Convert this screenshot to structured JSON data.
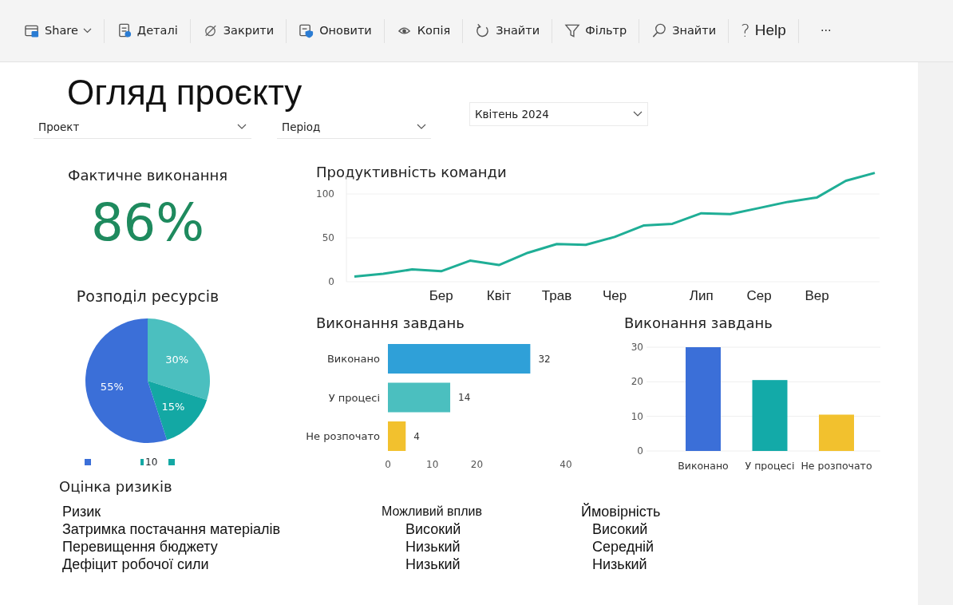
{
  "toolbar": [
    {
      "label": "Share",
      "dropdown": true
    },
    {
      "label": "Деталі"
    },
    {
      "label": "Закрити"
    },
    {
      "label": "Оновити"
    },
    {
      "label": "Копія"
    },
    {
      "label": "Знайти"
    },
    {
      "label": "Фільтр"
    },
    {
      "label": "Знайти"
    },
    {
      "label": "Help",
      "glyph": "?"
    },
    {
      "label": "···"
    }
  ],
  "title": "Огляд проєкту",
  "filters": [
    {
      "value": "Проект"
    },
    {
      "value": "Період"
    },
    {
      "value": "Квітень 2024"
    }
  ],
  "kpi": {
    "title": "Фактичне виконання",
    "value": "86%"
  },
  "resources": {
    "title": "Розподіл ресурсів",
    "chart_data": {
      "type": "pie",
      "values": [
        30,
        15,
        55
      ],
      "colors": [
        "#4bbfbf",
        "#13a8a4",
        "#3b6fd8"
      ],
      "data_labels": true,
      "value_labels": [
        "30%",
        "15%",
        "55%"
      ]
    },
    "legend": [
      {
        "color": "#3b6fd8"
      },
      {
        "color": "#13a8a4",
        "label": "10"
      },
      {
        "color": "#13a8a4"
      }
    ]
  },
  "productivity": {
    "title": "Продуктивність команди",
    "chart_data": {
      "type": "line",
      "categories": [
        null,
        null,
        null,
        "Бер",
        null,
        "Квіт",
        null,
        "Трав",
        null,
        "Чер",
        null,
        null,
        "Лип",
        null,
        "Сер",
        null,
        "Вер",
        null,
        null
      ],
      "series": [
        {
          "color": "#1fae96",
          "values": [
            6,
            9,
            14,
            12,
            24,
            19,
            33,
            43,
            42,
            51,
            64,
            66,
            78,
            77,
            84,
            91,
            96,
            115,
            124
          ]
        }
      ],
      "ylim": [
        0,
        125
      ],
      "yticks": [
        0,
        50,
        100
      ]
    }
  },
  "tasks_bar": {
    "title": "Виконання завдань",
    "chart_data": {
      "type": "bar",
      "orientation": "horizontal",
      "stacked": true,
      "categories": [
        "Виконано",
        "У процесі",
        "Не розпочато"
      ],
      "series": [
        {
          "color": "#2fa0d8",
          "values": [
            32,
            null,
            null
          ]
        },
        {
          "color": "#4bbfbf",
          "values": [
            null,
            14,
            null
          ]
        },
        {
          "color": "#f2c12e",
          "values": [
            null,
            null,
            4
          ]
        }
      ],
      "xlim": [
        0,
        40
      ],
      "xticks": [
        0,
        10,
        20,
        40
      ],
      "data_labels": true
    }
  },
  "tasks_column": {
    "title": "Виконання завдань",
    "chart_data": {
      "type": "bar",
      "orientation": "vertical",
      "stacked": true,
      "categories": [
        "Виконано",
        "У процесі",
        "Не розпочато"
      ],
      "series": [
        {
          "color": "#3b6fd8",
          "values": [
            30,
            null,
            null
          ]
        },
        {
          "color": "#13aaa8",
          "values": [
            null,
            20.5,
            null
          ]
        },
        {
          "color": "#f2c12e",
          "values": [
            null,
            null,
            10.5
          ]
        }
      ],
      "ylim": [
        0,
        30
      ],
      "yticks": [
        0,
        10,
        20,
        30
      ]
    }
  },
  "risks": {
    "title": "Оцінка ризиків",
    "columns": [
      "Ризик",
      "Можливий вплив",
      "Ймовірність"
    ],
    "rows": [
      [
        "Затримка постачання матеріалів",
        "Високий",
        "Високий"
      ],
      [
        "Перевищення бюджету",
        "Низький",
        "Середній"
      ],
      [
        "Дефіцит робочої сили",
        "Низький",
        "Низький"
      ]
    ]
  }
}
